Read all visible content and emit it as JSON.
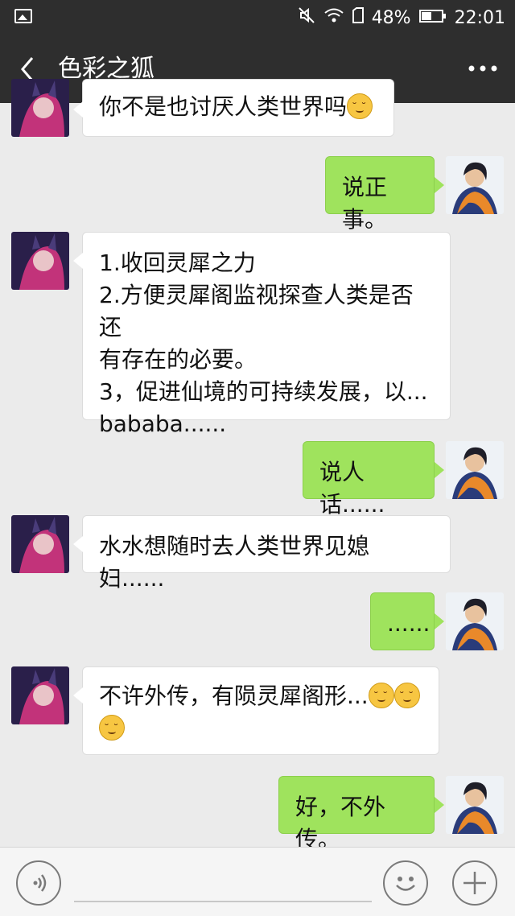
{
  "status_bar": {
    "battery_percent": "48%",
    "time": "22:01"
  },
  "header": {
    "title": "色彩之狐",
    "back_icon": "chevron-left-icon",
    "more_icon": "more-dots-icon"
  },
  "messages": [
    {
      "side": "left",
      "text": "你不是也讨厌人类世界吗",
      "emoji": true
    },
    {
      "side": "right",
      "text": "说正事。"
    },
    {
      "side": "left",
      "lines": [
        "1.收回灵犀之力",
        "2.方便灵犀阁监视探查人类是否还",
        "有存在的必要。",
        "3，促进仙境的可持续发展，以...",
        "bababa......"
      ]
    },
    {
      "side": "right",
      "text": "说人话......"
    },
    {
      "side": "left",
      "text": "水水想随时去人类世界见媳妇......"
    },
    {
      "side": "right",
      "text": "......"
    },
    {
      "side": "left",
      "text": "不许外传，有陨灵犀阁形..."
    },
    {
      "side": "right",
      "text": "好，不外传。"
    }
  ],
  "input_bar": {
    "voice_icon": "voice-icon",
    "emoji_icon": "emoji-face-icon",
    "add_icon": "plus-icon"
  },
  "colors": {
    "header_bg": "#2e2e2e",
    "chat_bg": "#ebebeb",
    "bubble_self": "#9fe35d",
    "bubble_other": "#ffffff"
  }
}
